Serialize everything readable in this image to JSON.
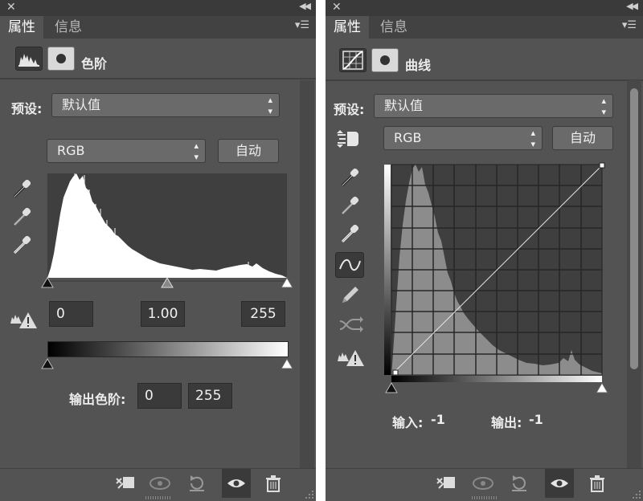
{
  "levels_panel": {
    "tabs": [
      "属性",
      "信息"
    ],
    "title": "色阶",
    "preset_label": "预设:",
    "preset_value": "默认值",
    "channel_value": "RGB",
    "auto_label": "自动",
    "input_levels": {
      "black": "0",
      "gamma": "1.00",
      "white": "255"
    },
    "output_label": "输出色阶:",
    "output_levels": {
      "black": "0",
      "white": "255"
    },
    "icons": [
      "close-icon",
      "collapse-icon",
      "panel-menu-icon",
      "levels-adjustment-icon",
      "layer-mask-icon",
      "black-point-eyedropper-icon",
      "gray-point-eyedropper-icon",
      "white-point-eyedropper-icon",
      "clipping-warning-icon",
      "clip-to-layer-icon",
      "view-previous-icon",
      "reset-icon",
      "visibility-eye-icon",
      "trash-icon"
    ]
  },
  "curves_panel": {
    "tabs": [
      "属性",
      "信息"
    ],
    "title": "曲线",
    "preset_label": "预设:",
    "preset_value": "默认值",
    "channel_value": "RGB",
    "auto_label": "自动",
    "input_label": "输入:",
    "input_value": "-1",
    "output_label": "输出:",
    "output_value": "-1",
    "icons": [
      "close-icon",
      "collapse-icon",
      "panel-menu-icon",
      "curves-adjustment-icon",
      "layer-mask-icon",
      "on-image-adjust-icon",
      "black-point-eyedropper-icon",
      "gray-point-eyedropper-icon",
      "white-point-eyedropper-icon",
      "curve-edit-points-icon",
      "pencil-draw-icon",
      "smooth-curve-icon",
      "clipping-warning-icon",
      "clip-to-layer-icon",
      "view-previous-icon",
      "reset-icon",
      "visibility-eye-icon",
      "trash-icon"
    ]
  },
  "colors": {
    "panel_bg": "#535353",
    "titlebar_bg": "#3a3a3a",
    "histogram_bg": "#3f3f3f",
    "histogram_fill_levels": "#ffffff",
    "histogram_fill_curves": "#8c8c8c"
  }
}
